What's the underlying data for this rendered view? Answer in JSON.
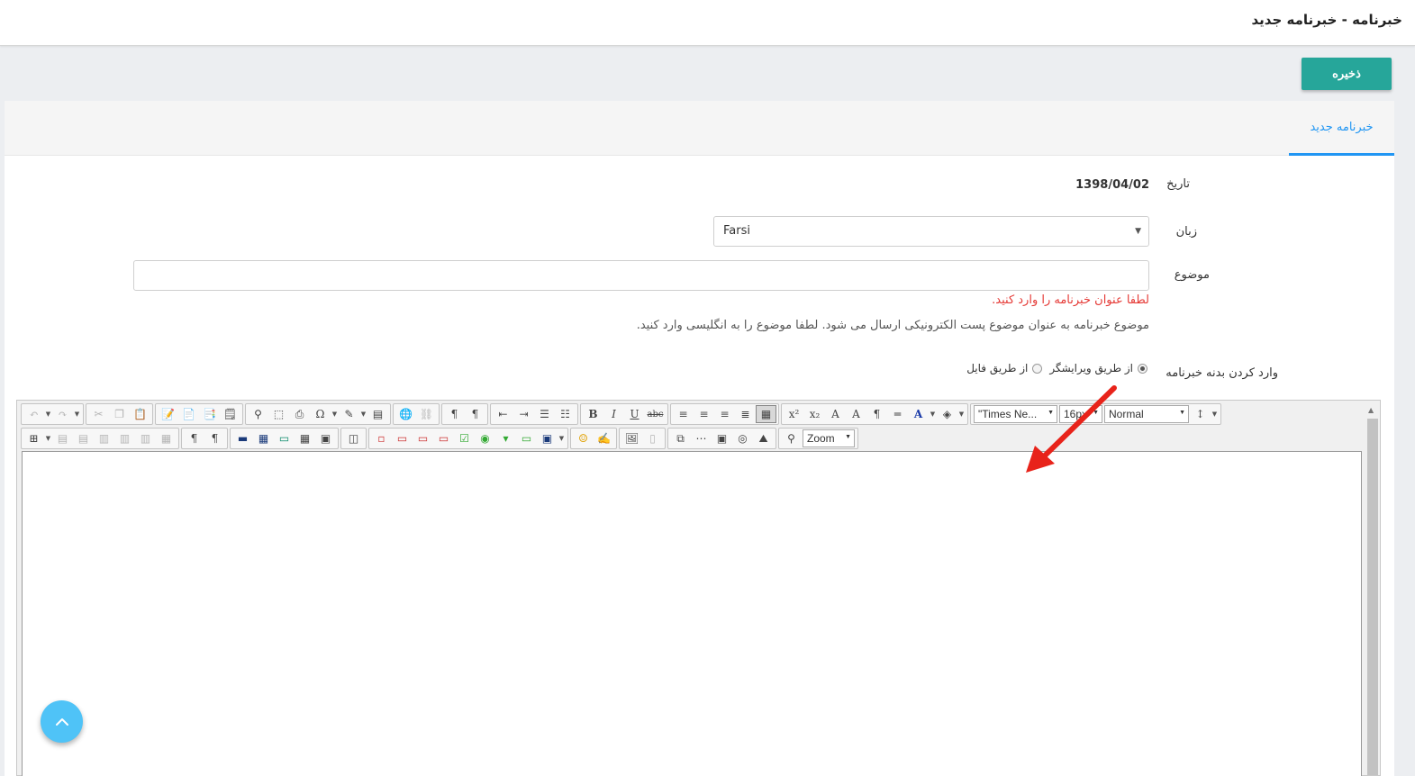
{
  "header": {
    "title": "خبرنامه - خبرنامه جدید"
  },
  "toolbar": {
    "save_label": "ذخیره"
  },
  "tabs": [
    {
      "label": "خبرنامه جدید",
      "active": true
    }
  ],
  "form": {
    "date": {
      "label": "تاریخ",
      "value": "1398/04/02"
    },
    "language": {
      "label": "زبان",
      "selected": "Farsi"
    },
    "subject": {
      "label": "موضوع",
      "value": "",
      "error": "لطفا عنوان خبرنامه را وارد کنید.",
      "hint": "موضوع خبرنامه به عنوان موضوع پست الکترونیکی ارسال می شود. لطفا موضوع را به انگلیسی وارد کنید."
    },
    "body_input": {
      "label": "وارد کردن بدنه خبرنامه",
      "options": [
        {
          "label": "از طریق ویرایشگر",
          "selected": true
        },
        {
          "label": "از طریق فایل",
          "selected": false
        }
      ]
    }
  },
  "editor": {
    "font_family": "\"Times Ne...",
    "font_size": "16px",
    "paragraph_style": "Normal",
    "zoom_label": "Zoom",
    "bold_label": "B",
    "italic_label": "I",
    "underline_label": "U",
    "strike_label": "abc"
  },
  "colors": {
    "accent": "#26a69a",
    "tab_active": "#2196f3",
    "error": "#e53935",
    "fab": "#4fc3f7",
    "annotation_arrow": "#e8231a"
  }
}
